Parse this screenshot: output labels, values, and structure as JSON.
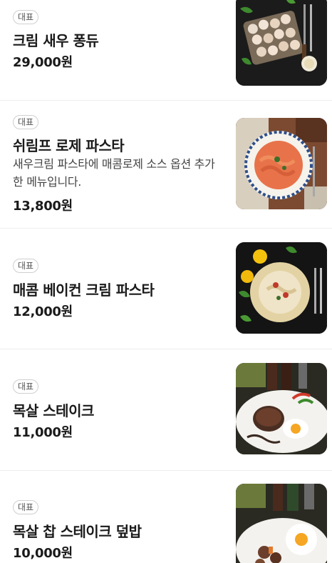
{
  "menu": {
    "items": [
      {
        "badge": "대표",
        "name": "크림 새우 퐁듀",
        "description": "",
        "price": "29,000원",
        "image_icon": "shrimp-fondue-photo"
      },
      {
        "badge": "대표",
        "name": "쉬림프 로제 파스타",
        "description": "새우크림 파스타에 매콤로제 소스 옵션 추가한 메뉴입니다.",
        "price": "13,800원",
        "image_icon": "rose-pasta-photo"
      },
      {
        "badge": "대표",
        "name": "매콤 베이컨 크림 파스타",
        "description": "",
        "price": "12,000원",
        "image_icon": "bacon-cream-pasta-photo"
      },
      {
        "badge": "대표",
        "name": "목살 스테이크",
        "description": "",
        "price": "11,000원",
        "image_icon": "pork-steak-photo"
      },
      {
        "badge": "대표",
        "name": "목살 찹 스테이크 덮밥",
        "description": "",
        "price": "10,000원",
        "image_icon": "chop-steak-rice-bowl-photo"
      }
    ]
  },
  "colors": {
    "text_primary": "#1a1a1a",
    "text_secondary": "#444444",
    "badge_border": "#cfcfcf",
    "divider": "#ededed"
  }
}
